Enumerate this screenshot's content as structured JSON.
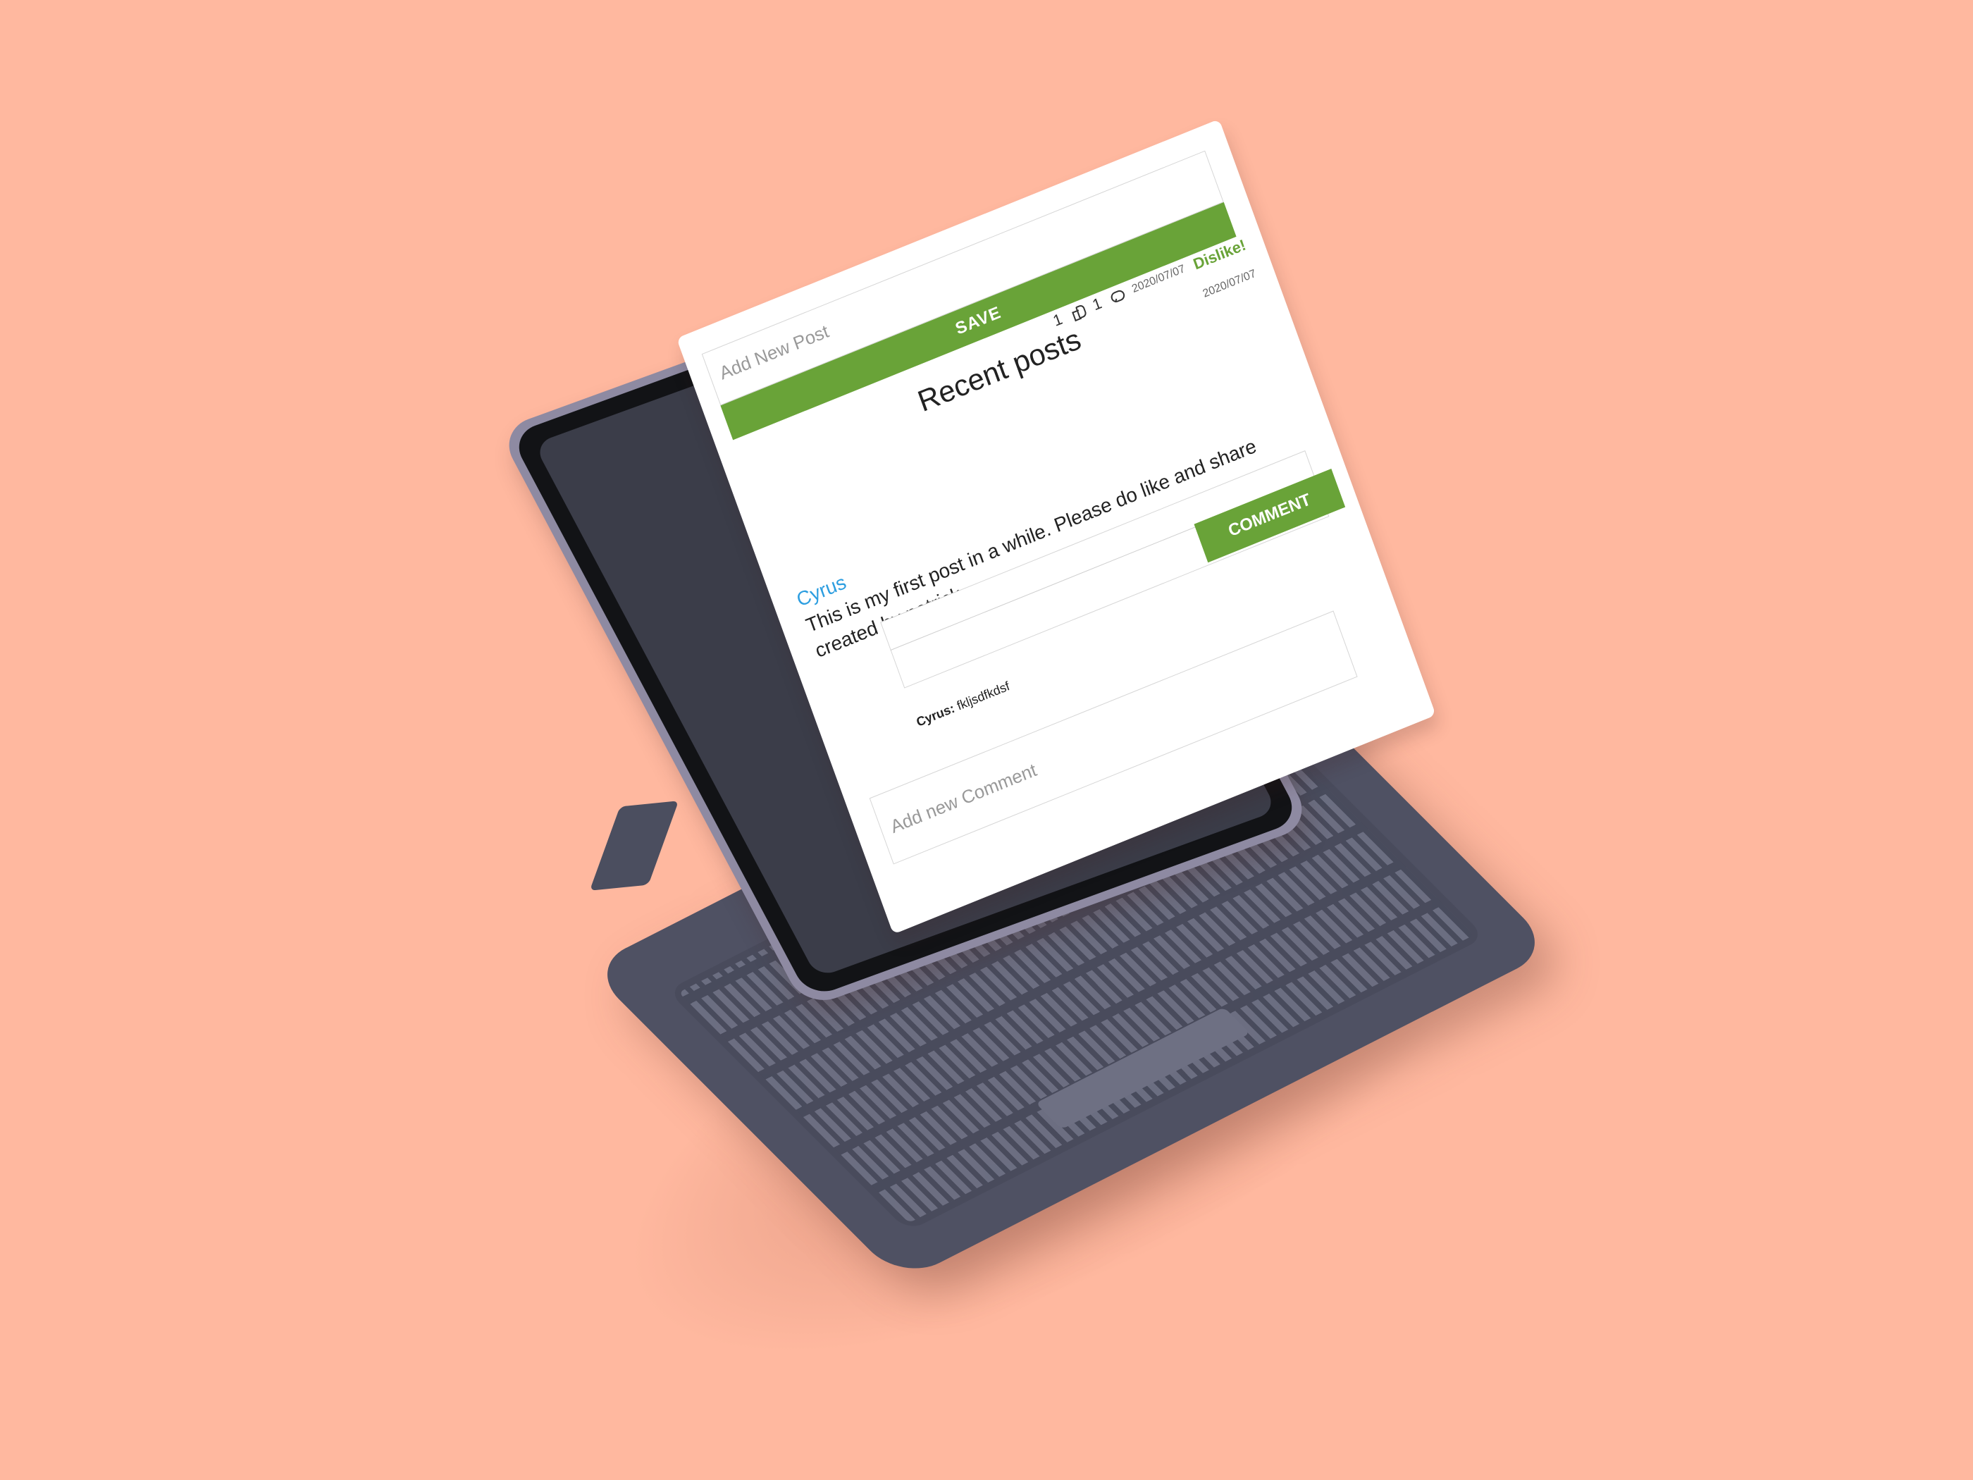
{
  "ui": {
    "post_input_placeholder": "Add New Post",
    "save_label": "SAVE",
    "page_title": "Recent posts",
    "post": {
      "likes": "1",
      "comments": "1",
      "date_top": "2020/07/07",
      "date_bottom": "2020/07/07",
      "dislike_label": "Dislike!",
      "author": "Cyrus",
      "text": "This is my first post in a while. Please do like and share created by patrick"
    },
    "comment": {
      "author": "Cyrus:",
      "text": "fkljsdfkdsf",
      "placeholder": "Add new Comment",
      "button_label": "COMMENT"
    }
  }
}
